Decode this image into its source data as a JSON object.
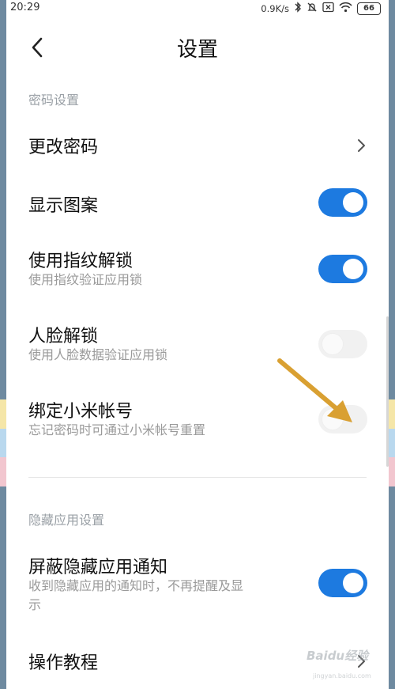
{
  "status_bar": {
    "time": "20:29",
    "network_speed": "0.9K/s",
    "battery": "66",
    "icons": [
      "bluetooth-icon",
      "mute-icon",
      "sim-off-icon",
      "wifi-icon",
      "battery-icon"
    ]
  },
  "header": {
    "title": "设置",
    "back_icon": "chevron-left-icon"
  },
  "sections": {
    "password": "密码设置",
    "hidden_apps": "隐藏应用设置"
  },
  "settings": {
    "change_password": {
      "label": "更改密码"
    },
    "show_pattern": {
      "label": "显示图案",
      "enabled": true
    },
    "fingerprint_unlock": {
      "label": "使用指纹解锁",
      "description": "使用指纹验证应用锁",
      "enabled": true
    },
    "face_unlock": {
      "label": "人脸解锁",
      "description": "使用人脸数据验证应用锁",
      "enabled": false
    },
    "bind_mi_account": {
      "label": "绑定小米帐号",
      "description": "忘记密码时可通过小米帐号重置",
      "enabled": false
    },
    "hide_notifications": {
      "label": "屏蔽隐藏应用通知",
      "description_line1": "收到隐藏应用的通知时，不再提醒及显",
      "description_line2": "示",
      "enabled": true
    },
    "tutorial": {
      "label": "操作教程"
    }
  },
  "watermark": {
    "text": "Baidu经验",
    "url": "jingyan.baidu.com"
  },
  "colors": {
    "toggle_on": "#1d7ae0",
    "toggle_off": "#f1f1f1",
    "annotation_arrow": "#d9a032"
  }
}
